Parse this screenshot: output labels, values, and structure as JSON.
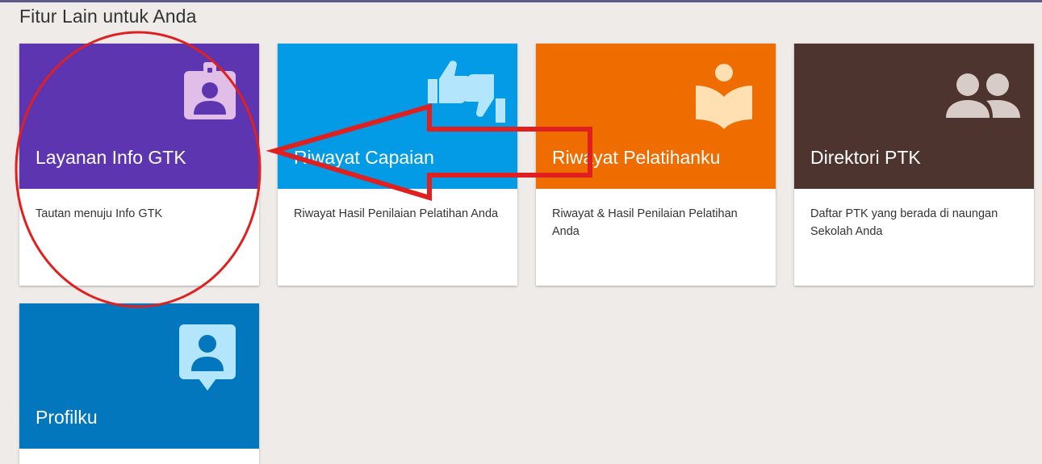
{
  "page": {
    "section_title": "Fitur Lain untuk Anda"
  },
  "cards": [
    {
      "title": "Layanan Info GTK",
      "description": "Tautan menuju Info GTK",
      "color": "#5e35b1",
      "icon": "id-badge-icon",
      "icon_color": "#e1bee7"
    },
    {
      "title": "Riwayat Capaian",
      "description": "Riwayat Hasil Penilaian Pelatihan Anda",
      "color": "#039be5",
      "icon": "thumbs-up-down-icon",
      "icon_color": "#b3e5fc"
    },
    {
      "title": "Riwayat Pelatihanku",
      "description": "Riwayat & Hasil Penilaian Pelatihan Anda",
      "color": "#ef6c00",
      "icon": "reading-book-icon",
      "icon_color": "#ffe0b2"
    },
    {
      "title": "Direktori PTK",
      "description": "Daftar PTK yang berada di naungan Sekolah Anda",
      "color": "#4e342e",
      "icon": "people-icon",
      "icon_color": "#d7ccc8"
    },
    {
      "title": "Profilku",
      "description": "",
      "color": "#0277bd",
      "icon": "person-pin-icon",
      "icon_color": "#b3e5fc"
    }
  ],
  "annotation": {
    "color": "#e02020",
    "shapes": [
      "ellipse",
      "left-arrow"
    ]
  }
}
